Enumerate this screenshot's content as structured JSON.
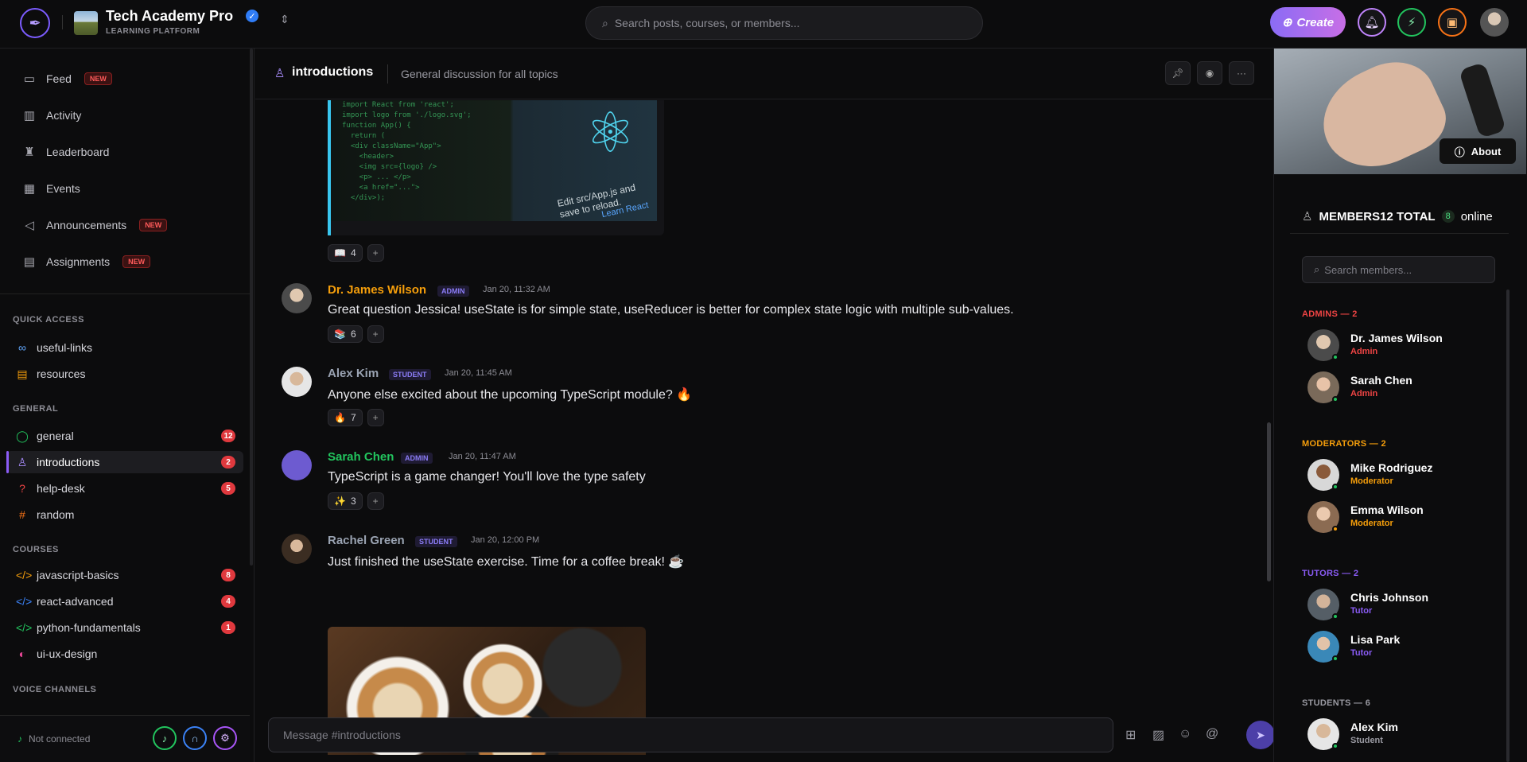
{
  "header": {
    "brand_name": "Tech Academy Pro",
    "brand_subtitle": "LEARNING PLATFORM",
    "search_placeholder": "Search posts, courses, or members...",
    "create_label": "Create"
  },
  "nav": [
    {
      "label": "Feed",
      "icon": "feed-icon",
      "badge": "NEW"
    },
    {
      "label": "Activity",
      "icon": "activity-icon",
      "badge": ""
    },
    {
      "label": "Leaderboard",
      "icon": "trophy-icon",
      "badge": ""
    },
    {
      "label": "Events",
      "icon": "calendar-icon",
      "badge": ""
    },
    {
      "label": "Announcements",
      "icon": "megaphone-icon",
      "badge": "NEW"
    },
    {
      "label": "Assignments",
      "icon": "document-icon",
      "badge": "NEW"
    }
  ],
  "sections": {
    "quick_access": "QUICK ACCESS",
    "general": "GENERAL",
    "courses": "COURSES",
    "voice": "VOICE CHANNELS"
  },
  "quick_access": [
    {
      "label": "useful-links",
      "icon": "link-icon"
    },
    {
      "label": "resources",
      "icon": "file-icon"
    }
  ],
  "general_channels": [
    {
      "label": "general",
      "icon": "chat-icon",
      "count": "12"
    },
    {
      "label": "introductions",
      "icon": "user-icon",
      "count": "2"
    },
    {
      "label": "help-desk",
      "icon": "help-icon",
      "count": "5"
    },
    {
      "label": "random",
      "icon": "hash-icon",
      "count": ""
    }
  ],
  "course_channels": [
    {
      "label": "javascript-basics",
      "icon": "code-icon",
      "count": "8"
    },
    {
      "label": "react-advanced",
      "icon": "code-icon",
      "count": "4"
    },
    {
      "label": "python-fundamentals",
      "icon": "code-icon",
      "count": "1"
    },
    {
      "label": "ui-ux-design",
      "icon": "palette-icon",
      "count": ""
    }
  ],
  "voice": {
    "status": "Not connected"
  },
  "channel": {
    "name": "introductions",
    "description": "General discussion for all topics"
  },
  "code_image": {
    "edit_text": "Edit src/App.js and save to reload.",
    "learn_text": "Learn React"
  },
  "messages": [
    {
      "author": "Dr. James Wilson",
      "role": "ADMIN",
      "time": "Jan 20, 11:32 AM",
      "text": "Great question Jessica! useState is for simple state, useReducer is better for complex state logic with multiple sub-values.",
      "reaction_emoji": "📚",
      "reaction_count": "6",
      "name_color": "#f59e0b"
    },
    {
      "author": "Alex Kim",
      "role": "STUDENT",
      "time": "Jan 20, 11:45 AM",
      "text": "Anyone else excited about the upcoming TypeScript module? 🔥",
      "reaction_emoji": "🔥",
      "reaction_count": "7",
      "name_color": "#9aa3b2"
    },
    {
      "author": "Sarah Chen",
      "role": "ADMIN",
      "time": "Jan 20, 11:47 AM",
      "text": "TypeScript is a game changer! You'll love the type safety",
      "reaction_emoji": "✨",
      "reaction_count": "3",
      "name_color": "#22c55e"
    },
    {
      "author": "Rachel Green",
      "role": "STUDENT",
      "time": "Jan 20, 12:00 PM",
      "text": "Just finished the useState exercise. Time for a coffee break! ☕",
      "reaction_emoji": "",
      "reaction_count": "",
      "name_color": "#9aa3b2"
    }
  ],
  "first_reaction": {
    "emoji": "📖",
    "count": "4"
  },
  "composer": {
    "placeholder": "Message #introductions"
  },
  "right": {
    "about_label": "About",
    "members_label": "MEMBERS12 TOTAL",
    "online_count": "8",
    "online_label": "online",
    "search_placeholder": "Search members..."
  },
  "member_groups": [
    {
      "title": "ADMINS — 2",
      "color": "#ef4444",
      "members": [
        {
          "name": "Dr. James Wilson",
          "role": "Admin",
          "status": "#22c55e"
        },
        {
          "name": "Sarah Chen",
          "role": "Admin",
          "status": "#22c55e"
        }
      ]
    },
    {
      "title": "MODERATORS — 2",
      "color": "#f59e0b",
      "members": [
        {
          "name": "Mike Rodriguez",
          "role": "Moderator",
          "status": "#22c55e"
        },
        {
          "name": "Emma Wilson",
          "role": "Moderator",
          "status": "#f59e0b"
        }
      ]
    },
    {
      "title": "TUTORS — 2",
      "color": "#8b5cf6",
      "members": [
        {
          "name": "Chris Johnson",
          "role": "Tutor",
          "status": "#22c55e"
        },
        {
          "name": "Lisa Park",
          "role": "Tutor",
          "status": "#22c55e"
        }
      ]
    },
    {
      "title": "STUDENTS — 6",
      "color": "#9a9aa2",
      "members": [
        {
          "name": "Alex Kim",
          "role": "Student",
          "status": "#22c55e"
        }
      ]
    }
  ]
}
